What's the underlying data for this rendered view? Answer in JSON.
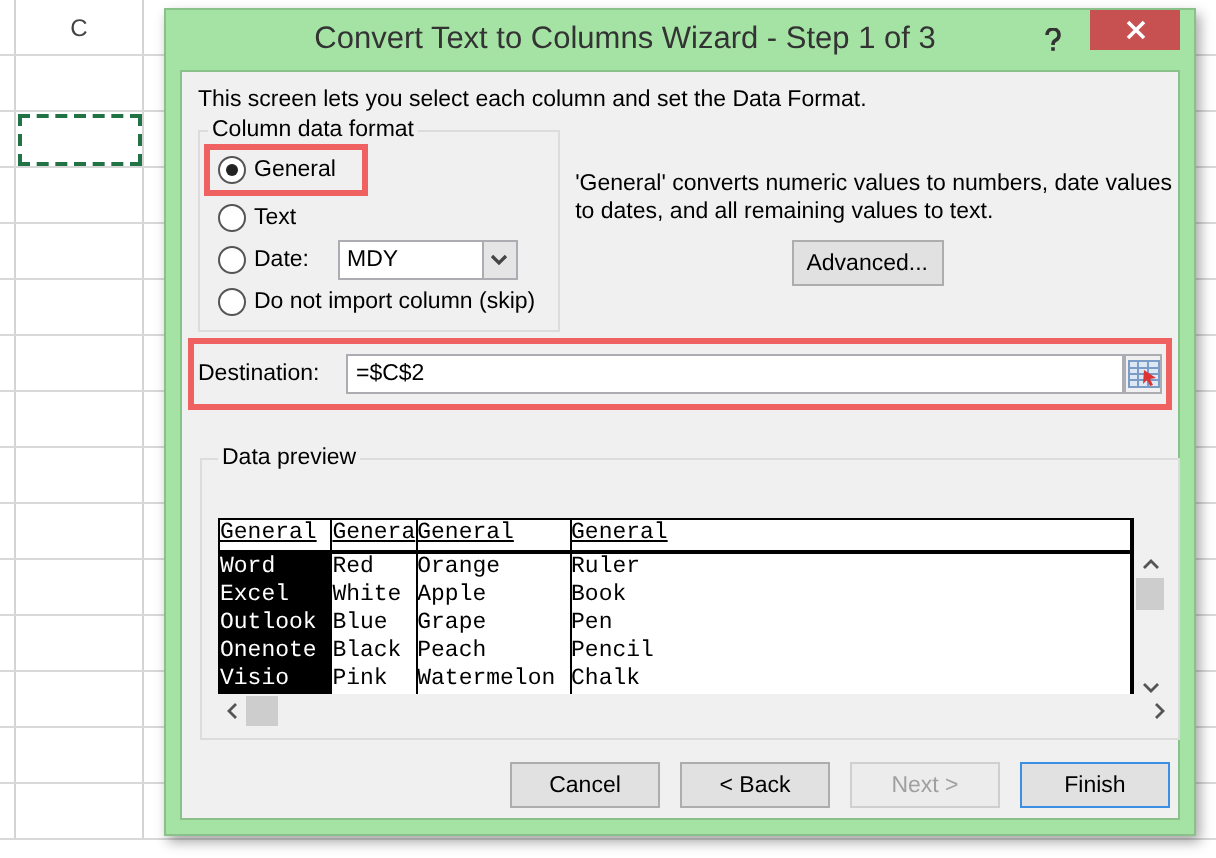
{
  "spreadsheet": {
    "column_header": "C"
  },
  "window": {
    "title": "Convert Text to Columns Wizard - Step 1 of 3"
  },
  "intro": "This screen lets you select each column and set the Data Format.",
  "format_group": {
    "label": "Column data format",
    "options": [
      {
        "kind": "plain",
        "label": "General",
        "selected": true,
        "highlighted": true
      },
      {
        "kind": "plain",
        "label": "Text",
        "selected": false,
        "highlighted": false
      },
      {
        "kind": "date",
        "label": "Date:",
        "selected": false,
        "highlighted": false,
        "value": "MDY"
      },
      {
        "kind": "plain",
        "label": "Do not import column (skip)",
        "selected": false,
        "highlighted": false
      }
    ]
  },
  "description": "'General' converts numeric values to numbers, date values to dates, and all remaining values to text.",
  "advanced_button": "Advanced...",
  "destination": {
    "label": "Destination:",
    "value": "=$C$2",
    "highlighted": true
  },
  "preview": {
    "label": "Data preview",
    "columns": [
      {
        "header": "General",
        "selected": true,
        "cells": [
          "Word",
          "Excel",
          "Outlook",
          "Onenote",
          "Visio"
        ]
      },
      {
        "header": "Genera",
        "selected": false,
        "cells": [
          "Red",
          "White",
          "Blue",
          "Black",
          "Pink"
        ]
      },
      {
        "header": "General",
        "selected": false,
        "cells": [
          "Orange",
          "Apple",
          "Grape",
          "Peach",
          "Watermelon"
        ]
      },
      {
        "header": "General",
        "selected": false,
        "cells": [
          "Ruler",
          "Book",
          "Pen",
          "Pencil",
          "Chalk"
        ]
      }
    ]
  },
  "buttons": [
    {
      "label": "Cancel",
      "disabled": false,
      "default": false
    },
    {
      "label": "< Back",
      "disabled": false,
      "default": false
    },
    {
      "label": "Next >",
      "disabled": true,
      "default": false
    },
    {
      "label": "Finish",
      "disabled": false,
      "default": true
    }
  ]
}
